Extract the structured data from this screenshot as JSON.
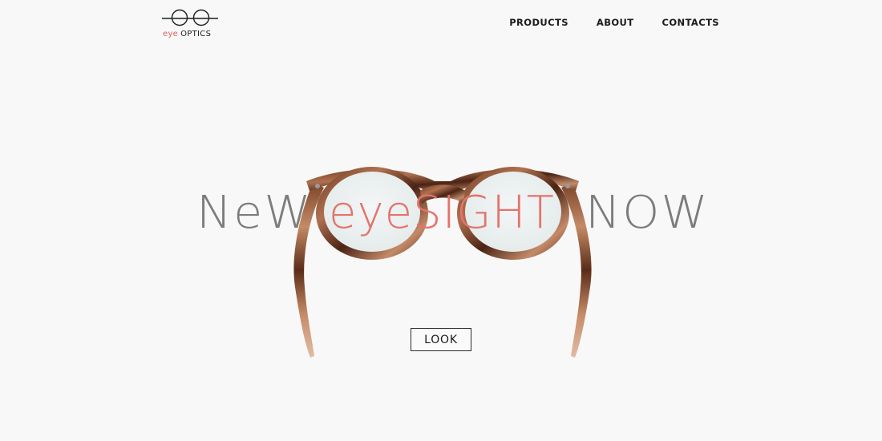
{
  "brand": {
    "logo_eye": "eye",
    "logo_optics": "OPTICS",
    "accent_color": "#e45a55"
  },
  "nav": {
    "items": [
      {
        "label": "PRODUCTS"
      },
      {
        "label": "ABOUT"
      },
      {
        "label": "CONTACTS"
      }
    ]
  },
  "hero": {
    "word_left": "NeW",
    "word_middle": "eyeSIGHT",
    "word_right": "NOW",
    "button_label": "LOOK",
    "text_color": "#7c7c7c",
    "highlight_color": "#e4736c"
  }
}
